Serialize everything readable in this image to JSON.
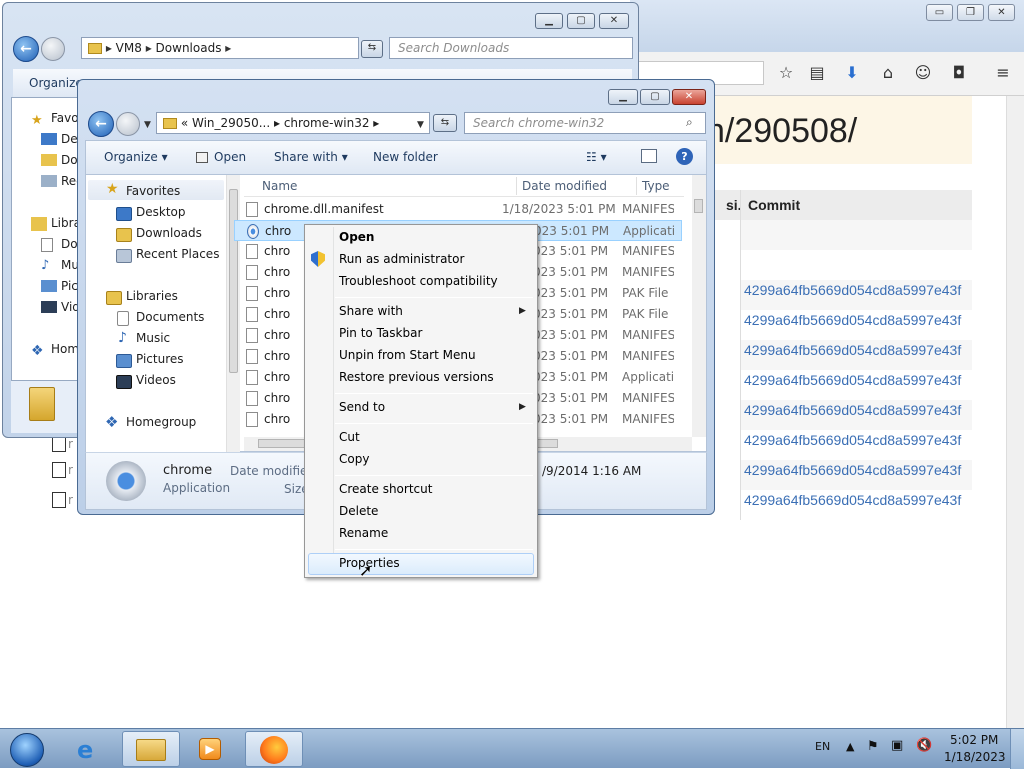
{
  "firefox": {
    "window_buttons": {
      "minimize": "▭",
      "restore": "❐",
      "close": "✕"
    },
    "heading": "n/290508/",
    "table": {
      "column_partial": "si...",
      "column_commit": "Commit",
      "rows": [
        "4299a64fb5669d054cd8a5997e43f",
        "4299a64fb5669d054cd8a5997e43f",
        "4299a64fb5669d054cd8a5997e43f",
        "4299a64fb5669d054cd8a5997e43f",
        "4299a64fb5669d054cd8a5997e43f",
        "4299a64fb5669d054cd8a5997e43f",
        "4299a64fb5669d054cd8a5997e43f",
        "4299a64fb5669d054cd8a5997e43f"
      ]
    },
    "toolbar_icons": [
      "star-icon",
      "reading-list-icon",
      "download-icon",
      "home-icon",
      "chat-icon",
      "pocket-icon",
      "menu-icon"
    ],
    "row_file_labels": [
      "r",
      "r",
      "r"
    ]
  },
  "explorer_back": {
    "address": {
      "parts": [
        "VM8",
        "Downloads"
      ]
    },
    "search_placeholder": "Search Downloads",
    "organize": "Organize",
    "nav": [
      {
        "label": "Favo",
        "icon": "star-icon"
      },
      {
        "label": "Des",
        "icon": "desktop-icon"
      },
      {
        "label": "Dov",
        "icon": "folder-icon"
      },
      {
        "label": "Rec",
        "icon": "recent-icon"
      },
      {
        "label": "Libra",
        "icon": "library-icon"
      },
      {
        "label": "Doc",
        "icon": "documents-icon"
      },
      {
        "label": "Mu",
        "icon": "music-icon"
      },
      {
        "label": "Pic",
        "icon": "pictures-icon"
      },
      {
        "label": "Vid",
        "icon": "videos-icon"
      },
      {
        "label": "Hom",
        "icon": "homegroup-icon"
      }
    ]
  },
  "explorer_front": {
    "address": {
      "prefix": "«",
      "parts": [
        "Win_29050...",
        "chrome-win32"
      ]
    },
    "search_placeholder": "Search chrome-win32",
    "commands": {
      "organize": "Organize",
      "open": "Open",
      "share_with": "Share with",
      "new_folder": "New folder"
    },
    "nav": {
      "favorites": "Favorites",
      "desktop": "Desktop",
      "downloads": "Downloads",
      "recent_places": "Recent Places",
      "libraries": "Libraries",
      "documents": "Documents",
      "music": "Music",
      "pictures": "Pictures",
      "videos": "Videos",
      "homegroup": "Homegroup"
    },
    "columns": {
      "name": "Name",
      "date": "Date modified",
      "type": "Type"
    },
    "files": [
      {
        "name": "chrome.dll.manifest",
        "date": "1/18/2023 5:01 PM",
        "type": "MANIFES"
      },
      {
        "name": "chro",
        "date": "/18/2023 5:01 PM",
        "type": "Applicati",
        "selected": true
      },
      {
        "name": "chro",
        "date": "/18/2023 5:01 PM",
        "type": "MANIFES"
      },
      {
        "name": "chro",
        "date": "/18/2023 5:01 PM",
        "type": "MANIFES"
      },
      {
        "name": "chro",
        "date": "/18/2023 5:01 PM",
        "type": "PAK File"
      },
      {
        "name": "chro",
        "date": "/18/2023 5:01 PM",
        "type": "PAK File"
      },
      {
        "name": "chro",
        "date": "/18/2023 5:01 PM",
        "type": "MANIFES"
      },
      {
        "name": "chro",
        "date": "/18/2023 5:01 PM",
        "type": "MANIFES"
      },
      {
        "name": "chro",
        "date": "/18/2023 5:01 PM",
        "type": "Applicati"
      },
      {
        "name": "chro",
        "date": "/18/2023 5:01 PM",
        "type": "MANIFES"
      },
      {
        "name": "chro",
        "date": "/18/2023 5:01 PM",
        "type": "MANIFES"
      }
    ],
    "details": {
      "name": "chrome",
      "kind": "Application",
      "date_label": "Date modified",
      "size_label": "Size",
      "date_value": "/9/2014 1:16 AM"
    }
  },
  "context_menu": {
    "items": [
      {
        "label": "Open",
        "bold": true
      },
      {
        "label": "Run as administrator",
        "icon": "shield-icon"
      },
      {
        "label": "Troubleshoot compatibility"
      },
      {
        "label": "Share with",
        "submenu": true
      },
      {
        "label": "Pin to Taskbar"
      },
      {
        "label": "Unpin from Start Menu"
      },
      {
        "label": "Restore previous versions"
      },
      {
        "label": "Send to",
        "submenu": true
      },
      {
        "label": "Cut"
      },
      {
        "label": "Copy"
      },
      {
        "label": "Create shortcut"
      },
      {
        "label": "Delete"
      },
      {
        "label": "Rename"
      },
      {
        "label": "Properties",
        "highlighted": true
      }
    ]
  },
  "taskbar": {
    "apps": [
      "internet-explorer-icon",
      "explorer-icon",
      "media-player-icon",
      "firefox-icon"
    ],
    "language": "EN",
    "time": "5:02 PM",
    "date": "1/18/2023"
  },
  "colors": {
    "accent": "#3b6fb5",
    "selection": "#cce8ff",
    "taskbar": "#8fb0d4"
  }
}
